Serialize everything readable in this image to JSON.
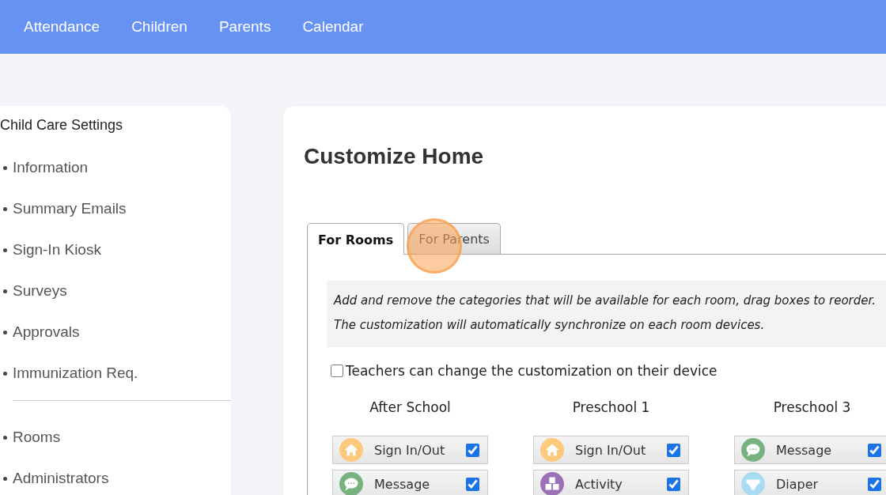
{
  "nav": [
    {
      "label": "Attendance"
    },
    {
      "label": "Children"
    },
    {
      "label": "Parents"
    },
    {
      "label": "Calendar"
    }
  ],
  "sidebar": {
    "title": "Child Care Settings",
    "groups": [
      [
        "Information",
        "Summary Emails",
        "Sign-In Kiosk",
        "Surveys",
        "Approvals",
        "Immunization Req."
      ],
      [
        "Rooms",
        "Administrators"
      ]
    ]
  },
  "page": {
    "title": "Customize Home",
    "tabs": [
      {
        "label": "For Rooms",
        "selected": true
      },
      {
        "label": "For Parents",
        "selected": false
      }
    ],
    "info": [
      "Add and remove the categories that will be available for each room, drag boxes to reorder.",
      "The customization will automatically synchronize on each room devices."
    ],
    "teacher_option": {
      "label": "Teachers can change the customization on their device",
      "checked": false
    },
    "rooms": [
      {
        "name": "After School",
        "categories": [
          {
            "label": "Sign In/Out",
            "kind": "home",
            "checked": true
          },
          {
            "label": "Message",
            "kind": "message",
            "checked": true
          }
        ]
      },
      {
        "name": "Preschool 1",
        "categories": [
          {
            "label": "Sign In/Out",
            "kind": "home",
            "checked": true
          },
          {
            "label": "Activity",
            "kind": "activity",
            "checked": true
          }
        ]
      },
      {
        "name": "Preschool 3",
        "categories": [
          {
            "label": "Message",
            "kind": "message",
            "checked": true
          },
          {
            "label": "Diaper",
            "kind": "diaper",
            "checked": true
          }
        ]
      }
    ]
  }
}
